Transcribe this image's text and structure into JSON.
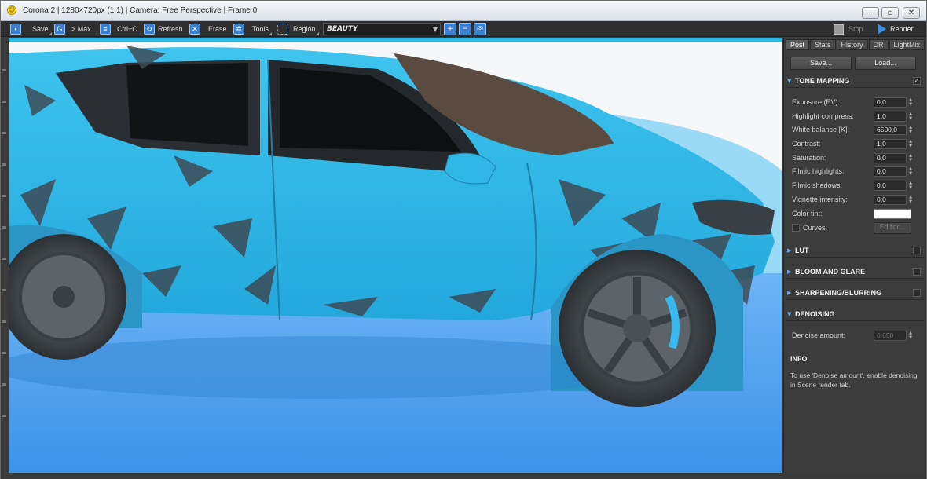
{
  "window": {
    "title": "Corona 2 | 1280×720px (1:1) | Camera: Free Perspective | Frame 0",
    "controls": [
      "minimize",
      "maximize",
      "close"
    ]
  },
  "toolbar": {
    "save_label": "Save",
    "max_label": "> Max",
    "copy_label": "Ctrl+C",
    "refresh_label": "Refresh",
    "erase_label": "Erase",
    "tools_label": "Tools",
    "region_label": "Region",
    "pass_value": "BEAUTY",
    "stop_label": "Stop",
    "render_label": "Render",
    "icons": [
      "save-icon",
      "max-icon",
      "copy-icon",
      "refresh-icon",
      "erase-icon",
      "tools-icon",
      "region-icon",
      "zoom-in-icon",
      "zoom-out-icon",
      "zoom-fit-icon",
      "stop-icon",
      "render-icon"
    ],
    "accent": "#3b7fd1"
  },
  "panel": {
    "tabs": [
      "Post",
      "Stats",
      "History",
      "DR",
      "LightMix"
    ],
    "active_tab": "Post",
    "save_label": "Save...",
    "load_label": "Load...",
    "tone_mapping": {
      "title": "TONE MAPPING",
      "enabled": "✓",
      "params": [
        {
          "label": "Exposure (EV):",
          "value": "0,0"
        },
        {
          "label": "Highlight compress:",
          "value": "1,0"
        },
        {
          "label": "White balance [K]:",
          "value": "6500,0"
        },
        {
          "label": "Contrast:",
          "value": "1,0"
        },
        {
          "label": "Saturation:",
          "value": "0,0"
        },
        {
          "label": "Filmic highlights:",
          "value": "0,0"
        },
        {
          "label": "Filmic shadows:",
          "value": "0,0"
        },
        {
          "label": "Vignette intensity:",
          "value": "0,0"
        }
      ],
      "color_tint_label": "Color tint:",
      "color_tint": "#ffffff",
      "curves_label": "Curves:",
      "editor_label": "Editor..."
    },
    "sections": {
      "lut": "LUT",
      "bloom": "BLOOM AND GLARE",
      "sharpen": "SHARPENING/BLURRING",
      "denoise": "DENOISING"
    },
    "denoise_label": "Denoise amount:",
    "denoise_value": "0,650",
    "info_title": "INFO",
    "info_text": "To use 'Denoise amount', enable denoising in Scene render tab."
  },
  "viewport": {
    "subject": "rendered car",
    "car_color": "#2fb6e6",
    "floor_color": "#4a9ff0",
    "background_color": "#f4f6f8"
  }
}
